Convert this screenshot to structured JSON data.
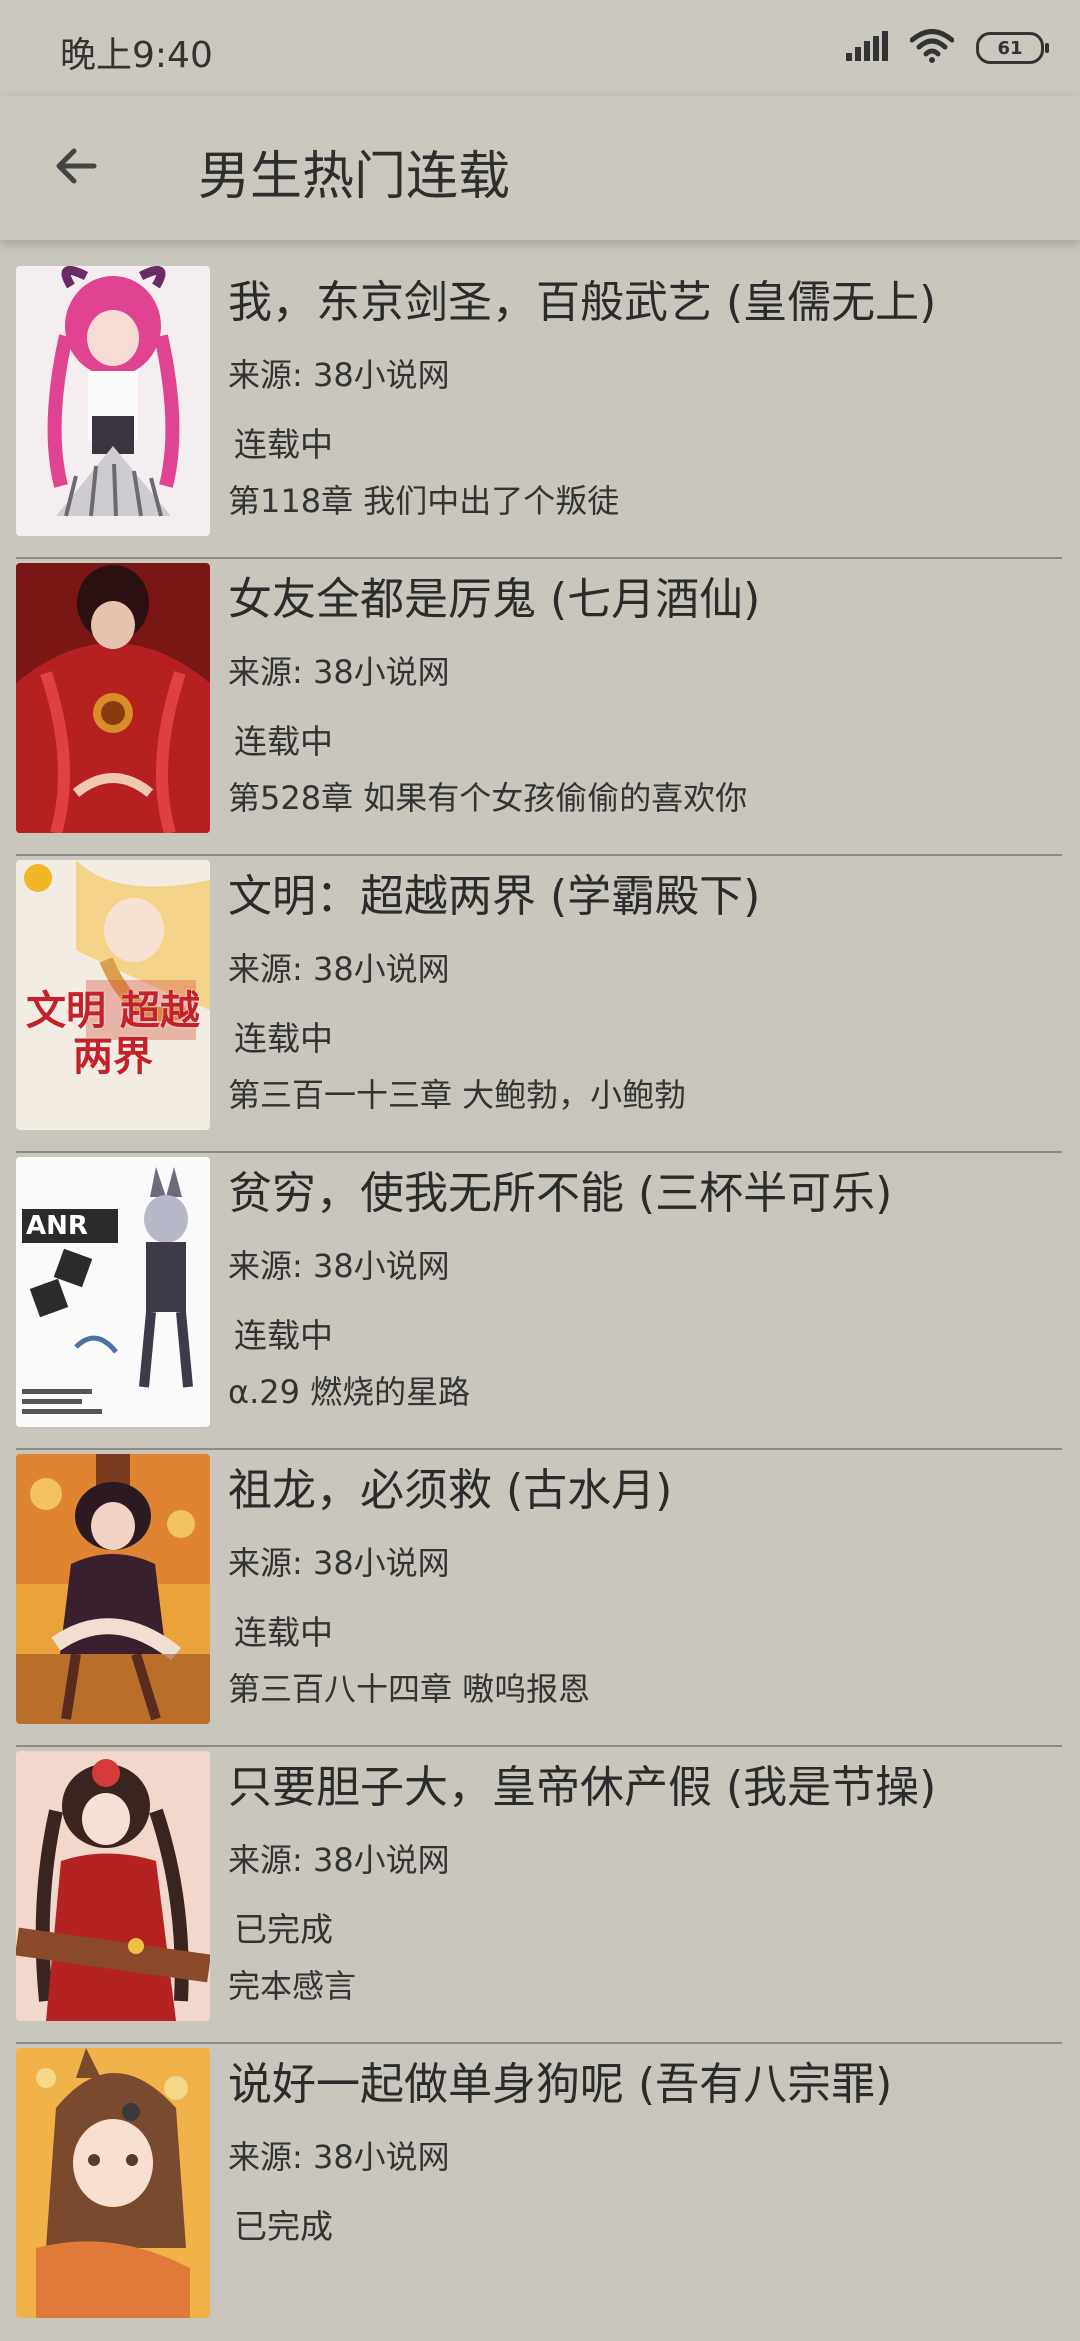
{
  "status_bar": {
    "time": "晚上9:40",
    "battery": "61",
    "icons": [
      "signal-icon",
      "wifi-icon",
      "battery-icon"
    ]
  },
  "header": {
    "back_icon": "arrow-left-icon",
    "title": "男生热门连载"
  },
  "books": [
    {
      "title": "我，东京剑圣，百般武艺 (皇儒无上)",
      "source": "来源: 38小说网",
      "status": "连载中",
      "chapter": "第118章 我们中出了个叛徒"
    },
    {
      "title": "女友全都是厉鬼 (七月酒仙)",
      "source": "来源: 38小说网",
      "status": "连载中",
      "chapter": "第528章 如果有个女孩偷偷的喜欢你"
    },
    {
      "title": "文明：超越两界 (学霸殿下)",
      "source": "来源: 38小说网",
      "status": "连载中",
      "chapter": "第三百一十三章 大鲍勃，小鲍勃",
      "cover_text": "文明 超越两界"
    },
    {
      "title": "贫穷，使我无所不能 (三杯半可乐)",
      "source": "来源: 38小说网",
      "status": "连载中",
      "chapter": "α.29 燃烧的星路",
      "cover_text": "ANR"
    },
    {
      "title": "祖龙，必须救 (古水月)",
      "source": "来源: 38小说网",
      "status": "连载中",
      "chapter": "第三百八十四章 嗷呜报恩"
    },
    {
      "title": "只要胆子大，皇帝休产假 (我是节操)",
      "source": "来源: 38小说网",
      "status": "已完成",
      "chapter": "完本感言"
    },
    {
      "title": "说好一起做单身狗呢 (吾有八宗罪)",
      "source": "来源: 38小说网",
      "status": "已完成",
      "chapter": ""
    }
  ],
  "colors": {
    "background": "#c9c6bd",
    "divider": "#8e8b84",
    "text": "#2b2b2b"
  }
}
